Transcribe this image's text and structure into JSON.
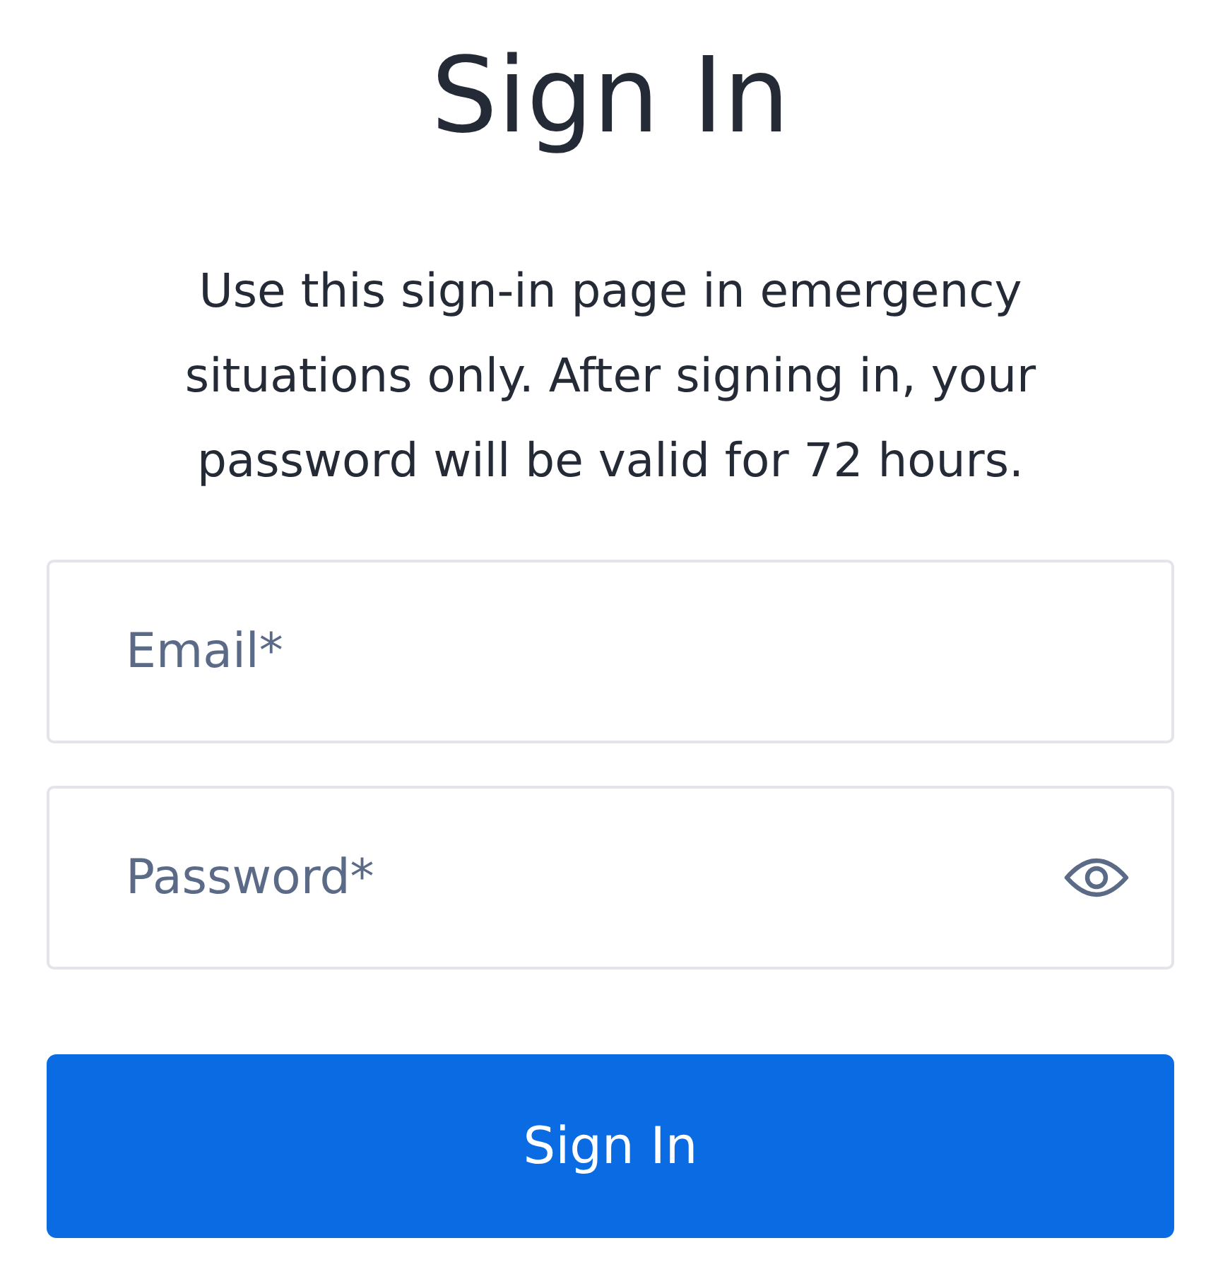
{
  "title": "Sign In",
  "description": "Use this sign-in page in emergency situations only. After signing in, your password will be valid for 72 hours.",
  "fields": [
    {
      "kind": "email",
      "placeholder": "Email*"
    },
    {
      "kind": "password",
      "placeholder": "Password*"
    }
  ],
  "submit_button": "Sign In"
}
